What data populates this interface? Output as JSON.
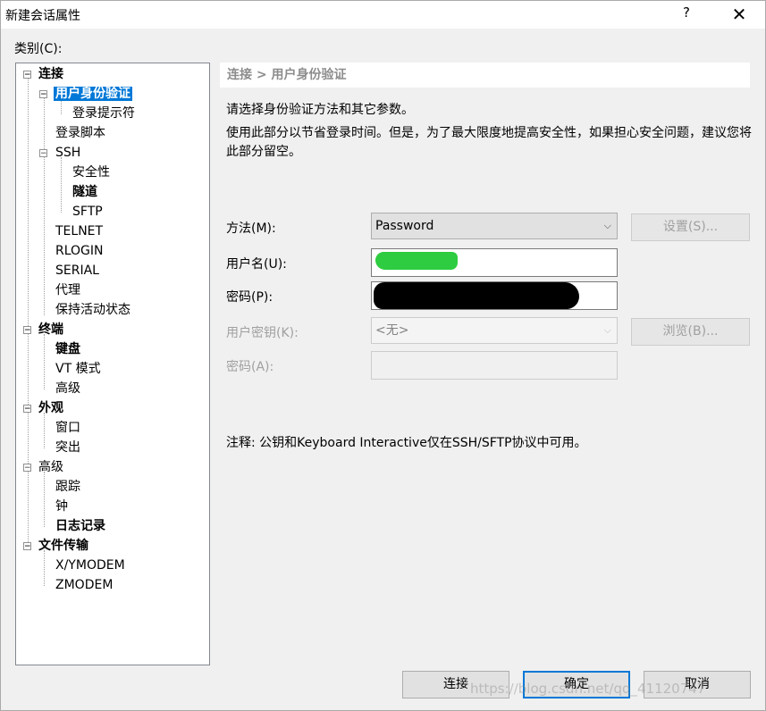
{
  "window": {
    "title": "新建会话属性",
    "help_symbol": "?",
    "close_symbol": "✕"
  },
  "category_label": "类别(C):",
  "tree": {
    "items": [
      {
        "label": "连接",
        "bold": true,
        "expander": "−"
      },
      {
        "label": "用户身份验证",
        "bold": true,
        "selected": true,
        "expander": "−"
      },
      {
        "label": "登录提示符"
      },
      {
        "label": "登录脚本"
      },
      {
        "label": "SSH",
        "expander": "−"
      },
      {
        "label": "安全性"
      },
      {
        "label": "隧道",
        "bold": true
      },
      {
        "label": "SFTP"
      },
      {
        "label": "TELNET"
      },
      {
        "label": "RLOGIN"
      },
      {
        "label": "SERIAL"
      },
      {
        "label": "代理"
      },
      {
        "label": "保持活动状态"
      },
      {
        "label": "终端",
        "bold": true,
        "expander": "−"
      },
      {
        "label": "键盘",
        "bold": true
      },
      {
        "label": "VT 模式"
      },
      {
        "label": "高级"
      },
      {
        "label": "外观",
        "bold": true,
        "expander": "−"
      },
      {
        "label": "窗口"
      },
      {
        "label": "突出"
      },
      {
        "label": "高级",
        "expander": "−"
      },
      {
        "label": "跟踪"
      },
      {
        "label": "钟"
      },
      {
        "label": "日志记录",
        "bold": true
      },
      {
        "label": "文件传输",
        "bold": true,
        "expander": "−"
      },
      {
        "label": "X/YMODEM"
      },
      {
        "label": "ZMODEM"
      }
    ]
  },
  "breadcrumb": "连接 > 用户身份验证",
  "description": {
    "line1": "请选择身份验证方法和其它参数。",
    "line2": "使用此部分以节省登录时间。但是，为了最大限度地提高安全性，如果担心安全问题，建议您将此部分留空。"
  },
  "form": {
    "method_label": "方法(M):",
    "method_value": "Password",
    "settings_button": "设置(S)...",
    "username_label": "用户名(U):",
    "password_label": "密码(P):",
    "userkey_label": "用户密钥(K):",
    "userkey_value": "<无>",
    "browse_button": "浏览(B)...",
    "passphrase_label": "密码(A):"
  },
  "note": "注释: 公钥和Keyboard Interactive仅在SSH/SFTP协议中可用。",
  "buttons": {
    "connect": "连接",
    "ok": "确定",
    "cancel": "取消"
  },
  "watermark": "https://blog.csdn.net/qq_41120747"
}
